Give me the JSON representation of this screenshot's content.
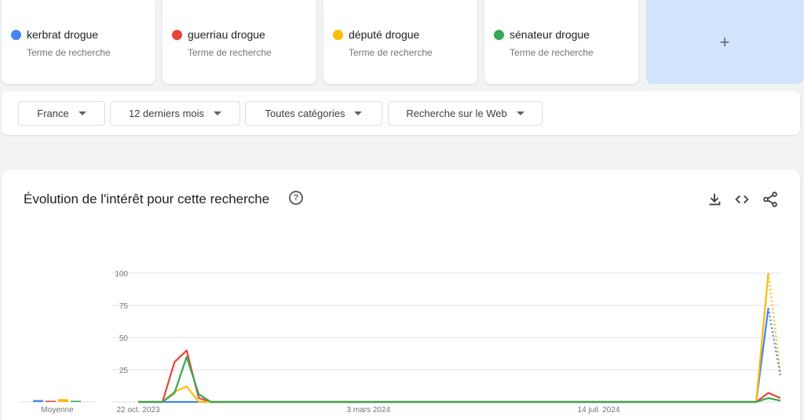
{
  "terms": [
    {
      "name": "kerbrat drogue",
      "subtitle": "Terme de recherche",
      "color": "#4285f4"
    },
    {
      "name": "guerriau drogue",
      "subtitle": "Terme de recherche",
      "color": "#ea4335"
    },
    {
      "name": "député drogue",
      "subtitle": "Terme de recherche",
      "color": "#fbbc04"
    },
    {
      "name": "sénateur drogue",
      "subtitle": "Terme de recherche",
      "color": "#34a853"
    }
  ],
  "add_term": {
    "label": "+"
  },
  "filters": {
    "region": "France",
    "period": "12 derniers mois",
    "category": "Toutes catégories",
    "source": "Recherche sur le Web"
  },
  "panel": {
    "title": "Évolution de l'intérêt pour cette recherche",
    "help_label": "?",
    "download_icon": "download-icon",
    "embed_icon": "embed-code-icon",
    "share_icon": "share-icon"
  },
  "chart_data": {
    "type": "line",
    "x_ticks": [
      "22 oct. 2023",
      "3 mars 2024",
      "14 juil. 2024"
    ],
    "y_ticks": [
      25,
      50,
      75,
      100
    ],
    "ylim": [
      0,
      100
    ],
    "grid": true,
    "average_label": "Moyenne",
    "weeks": 54,
    "series": [
      {
        "name": "kerbrat drogue",
        "color": "#4285f4",
        "values": [
          0,
          0,
          0,
          0,
          0,
          0,
          0,
          0,
          0,
          0,
          0,
          0,
          0,
          0,
          0,
          0,
          0,
          0,
          0,
          0,
          0,
          0,
          0,
          0,
          0,
          0,
          0,
          0,
          0,
          0,
          0,
          0,
          0,
          0,
          0,
          0,
          0,
          0,
          0,
          0,
          0,
          0,
          0,
          0,
          0,
          0,
          0,
          0,
          0,
          0,
          0,
          0,
          73,
          20
        ],
        "partial_from": 52,
        "average": 2
      },
      {
        "name": "guerriau drogue",
        "color": "#ea4335",
        "values": [
          0,
          0,
          0,
          31,
          40,
          3,
          0,
          0,
          0,
          0,
          0,
          0,
          0,
          0,
          0,
          0,
          0,
          0,
          0,
          0,
          0,
          0,
          0,
          0,
          0,
          0,
          0,
          0,
          0,
          0,
          0,
          0,
          0,
          0,
          0,
          0,
          0,
          0,
          0,
          0,
          0,
          0,
          0,
          0,
          0,
          0,
          0,
          0,
          0,
          0,
          0,
          0,
          7,
          3
        ],
        "partial_from": 53,
        "average": 1
      },
      {
        "name": "député drogue",
        "color": "#fbbc04",
        "values": [
          0,
          0,
          0,
          8,
          12,
          0,
          0,
          0,
          0,
          0,
          0,
          0,
          0,
          0,
          0,
          0,
          0,
          0,
          0,
          0,
          0,
          0,
          0,
          0,
          0,
          0,
          0,
          0,
          0,
          0,
          0,
          0,
          0,
          0,
          0,
          0,
          0,
          0,
          0,
          0,
          0,
          0,
          0,
          0,
          0,
          0,
          0,
          0,
          0,
          0,
          0,
          0,
          100,
          23
        ],
        "partial_from": 52,
        "average": 3
      },
      {
        "name": "sénateur drogue",
        "color": "#34a853",
        "values": [
          0,
          0,
          0,
          7,
          35,
          6,
          0,
          0,
          0,
          0,
          0,
          0,
          0,
          0,
          0,
          0,
          0,
          0,
          0,
          0,
          0,
          0,
          0,
          0,
          0,
          0,
          0,
          0,
          0,
          0,
          0,
          0,
          0,
          0,
          0,
          0,
          0,
          0,
          0,
          0,
          0,
          0,
          0,
          0,
          0,
          0,
          0,
          0,
          0,
          0,
          0,
          0,
          3,
          1
        ],
        "partial_from": 53,
        "average": 1
      }
    ]
  }
}
